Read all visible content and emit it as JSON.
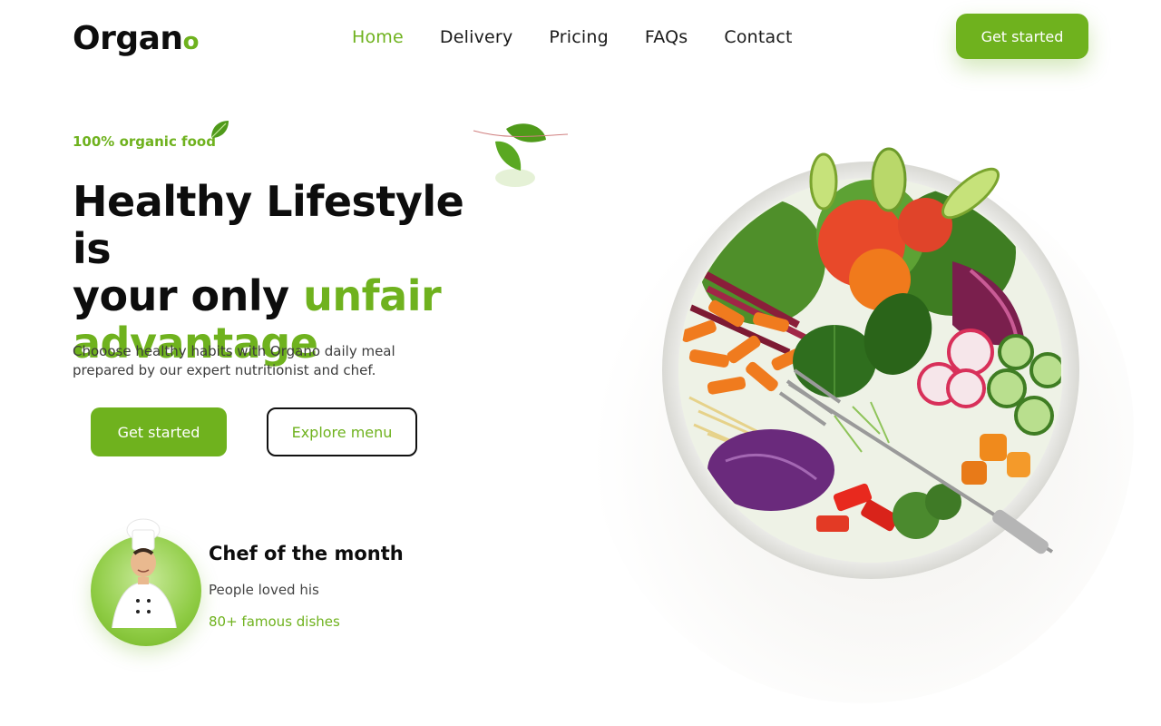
{
  "header": {
    "logo_main": "Organ",
    "logo_accent": "o",
    "nav": [
      {
        "label": "Home",
        "active": true
      },
      {
        "label": "Delivery",
        "active": false
      },
      {
        "label": "Pricing",
        "active": false
      },
      {
        "label": "FAQs",
        "active": false
      },
      {
        "label": "Contact",
        "active": false
      }
    ],
    "cta_label": "Get started"
  },
  "hero": {
    "tag": "100% organic food",
    "title_line1": "Healthy Lifestyle is",
    "title_line2_plain": "your only ",
    "title_line2_green": "unfair",
    "title_line3_green": "advantage",
    "description": "Chooose healthy habits with Organo daily meal prepared by our expert nutritionist and chef.",
    "primary_button": "Get started",
    "secondary_button": "Explore menu"
  },
  "chef": {
    "title": "Chef of the month",
    "subtitle": "People loved his",
    "dishes": "80+ famous dishes"
  },
  "colors": {
    "brand_green": "#6fb21e",
    "text_dark": "#0d0d0d"
  },
  "icons": [
    "leaf-icon",
    "floating-leaves",
    "salad-bowl-image",
    "chef-avatar"
  ]
}
